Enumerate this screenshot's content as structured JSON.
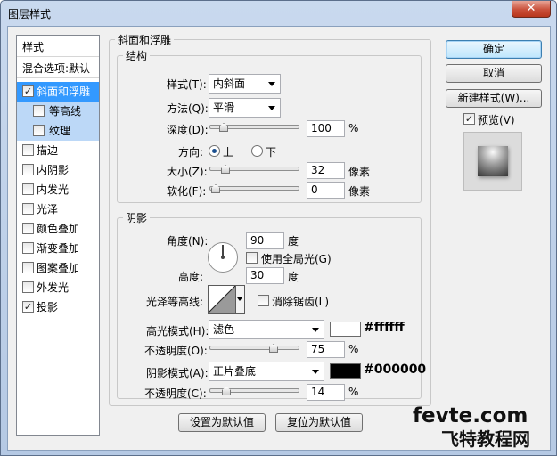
{
  "window": {
    "title": "图层样式",
    "close": "✕"
  },
  "left_list": {
    "header": "样式",
    "blend": "混合选项:默认",
    "items": [
      {
        "label": "斜面和浮雕",
        "checked": "✓"
      },
      {
        "label": "等高线",
        "checked": ""
      },
      {
        "label": "纹理",
        "checked": ""
      },
      {
        "label": "描边",
        "checked": ""
      },
      {
        "label": "内阴影",
        "checked": ""
      },
      {
        "label": "内发光",
        "checked": ""
      },
      {
        "label": "光泽",
        "checked": ""
      },
      {
        "label": "颜色叠加",
        "checked": ""
      },
      {
        "label": "渐变叠加",
        "checked": ""
      },
      {
        "label": "图案叠加",
        "checked": ""
      },
      {
        "label": "外发光",
        "checked": ""
      },
      {
        "label": "投影",
        "checked": "✓"
      }
    ]
  },
  "bevel": {
    "title": "斜面和浮雕",
    "structure": {
      "title": "结构",
      "style_label": "样式(T):",
      "style_value": "内斜面",
      "technique_label": "方法(Q):",
      "technique_value": "平滑",
      "depth_label": "深度(D):",
      "depth_value": "100",
      "depth_unit": "%",
      "depth_fraction": 0.1,
      "direction_label": "方向:",
      "dir_up": "上",
      "dir_down": "下",
      "size_label": "大小(Z):",
      "size_value": "32",
      "size_unit": "像素",
      "size_fraction": 0.13,
      "soften_label": "软化(F):",
      "soften_value": "0",
      "soften_unit": "像素",
      "soften_fraction": 0
    },
    "shading": {
      "title": "阴影",
      "angle_label": "角度(N):",
      "angle_value": "90",
      "angle_unit": "度",
      "global_light_label": "使用全局光(G)",
      "global_light_checked": "",
      "altitude_label": "高度:",
      "altitude_value": "30",
      "altitude_unit": "度",
      "gloss_label": "光泽等高线:",
      "antialias_label": "消除锯齿(L)",
      "antialias_checked": "",
      "highlight_label": "高光模式(H):",
      "highlight_value": "滤色",
      "highlight_color": "#ffffff",
      "highlight_hex": "#ffffff",
      "highlight_opacity_label": "不透明度(O):",
      "highlight_opacity_value": "75",
      "highlight_opacity_unit": "%",
      "highlight_opacity_fraction": 0.75,
      "shadow_label": "阴影模式(A):",
      "shadow_value": "正片叠底",
      "shadow_color": "#000000",
      "shadow_hex": "#000000",
      "shadow_opacity_label": "不透明度(C):",
      "shadow_opacity_value": "14",
      "shadow_opacity_unit": "%",
      "shadow_opacity_fraction": 0.14
    },
    "make_default": "设置为默认值",
    "reset_default": "复位为默认值"
  },
  "right": {
    "ok": "确定",
    "cancel": "取消",
    "new_style": "新建样式(W)...",
    "preview_label": "预览(V)",
    "preview_checked": "✓"
  },
  "watermark": {
    "line1": "fevte.com",
    "line2": "飞特教程网"
  }
}
